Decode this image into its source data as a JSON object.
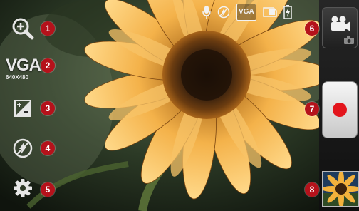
{
  "left_controls": {
    "resolution": {
      "label": "VGA",
      "sub": "640X480"
    }
  },
  "status": {
    "video_size": "VGA"
  },
  "badges": [
    "1",
    "2",
    "3",
    "4",
    "5",
    "6",
    "7",
    "8"
  ],
  "colors": {
    "badge": "#b5121b",
    "record": "#e3151c"
  }
}
